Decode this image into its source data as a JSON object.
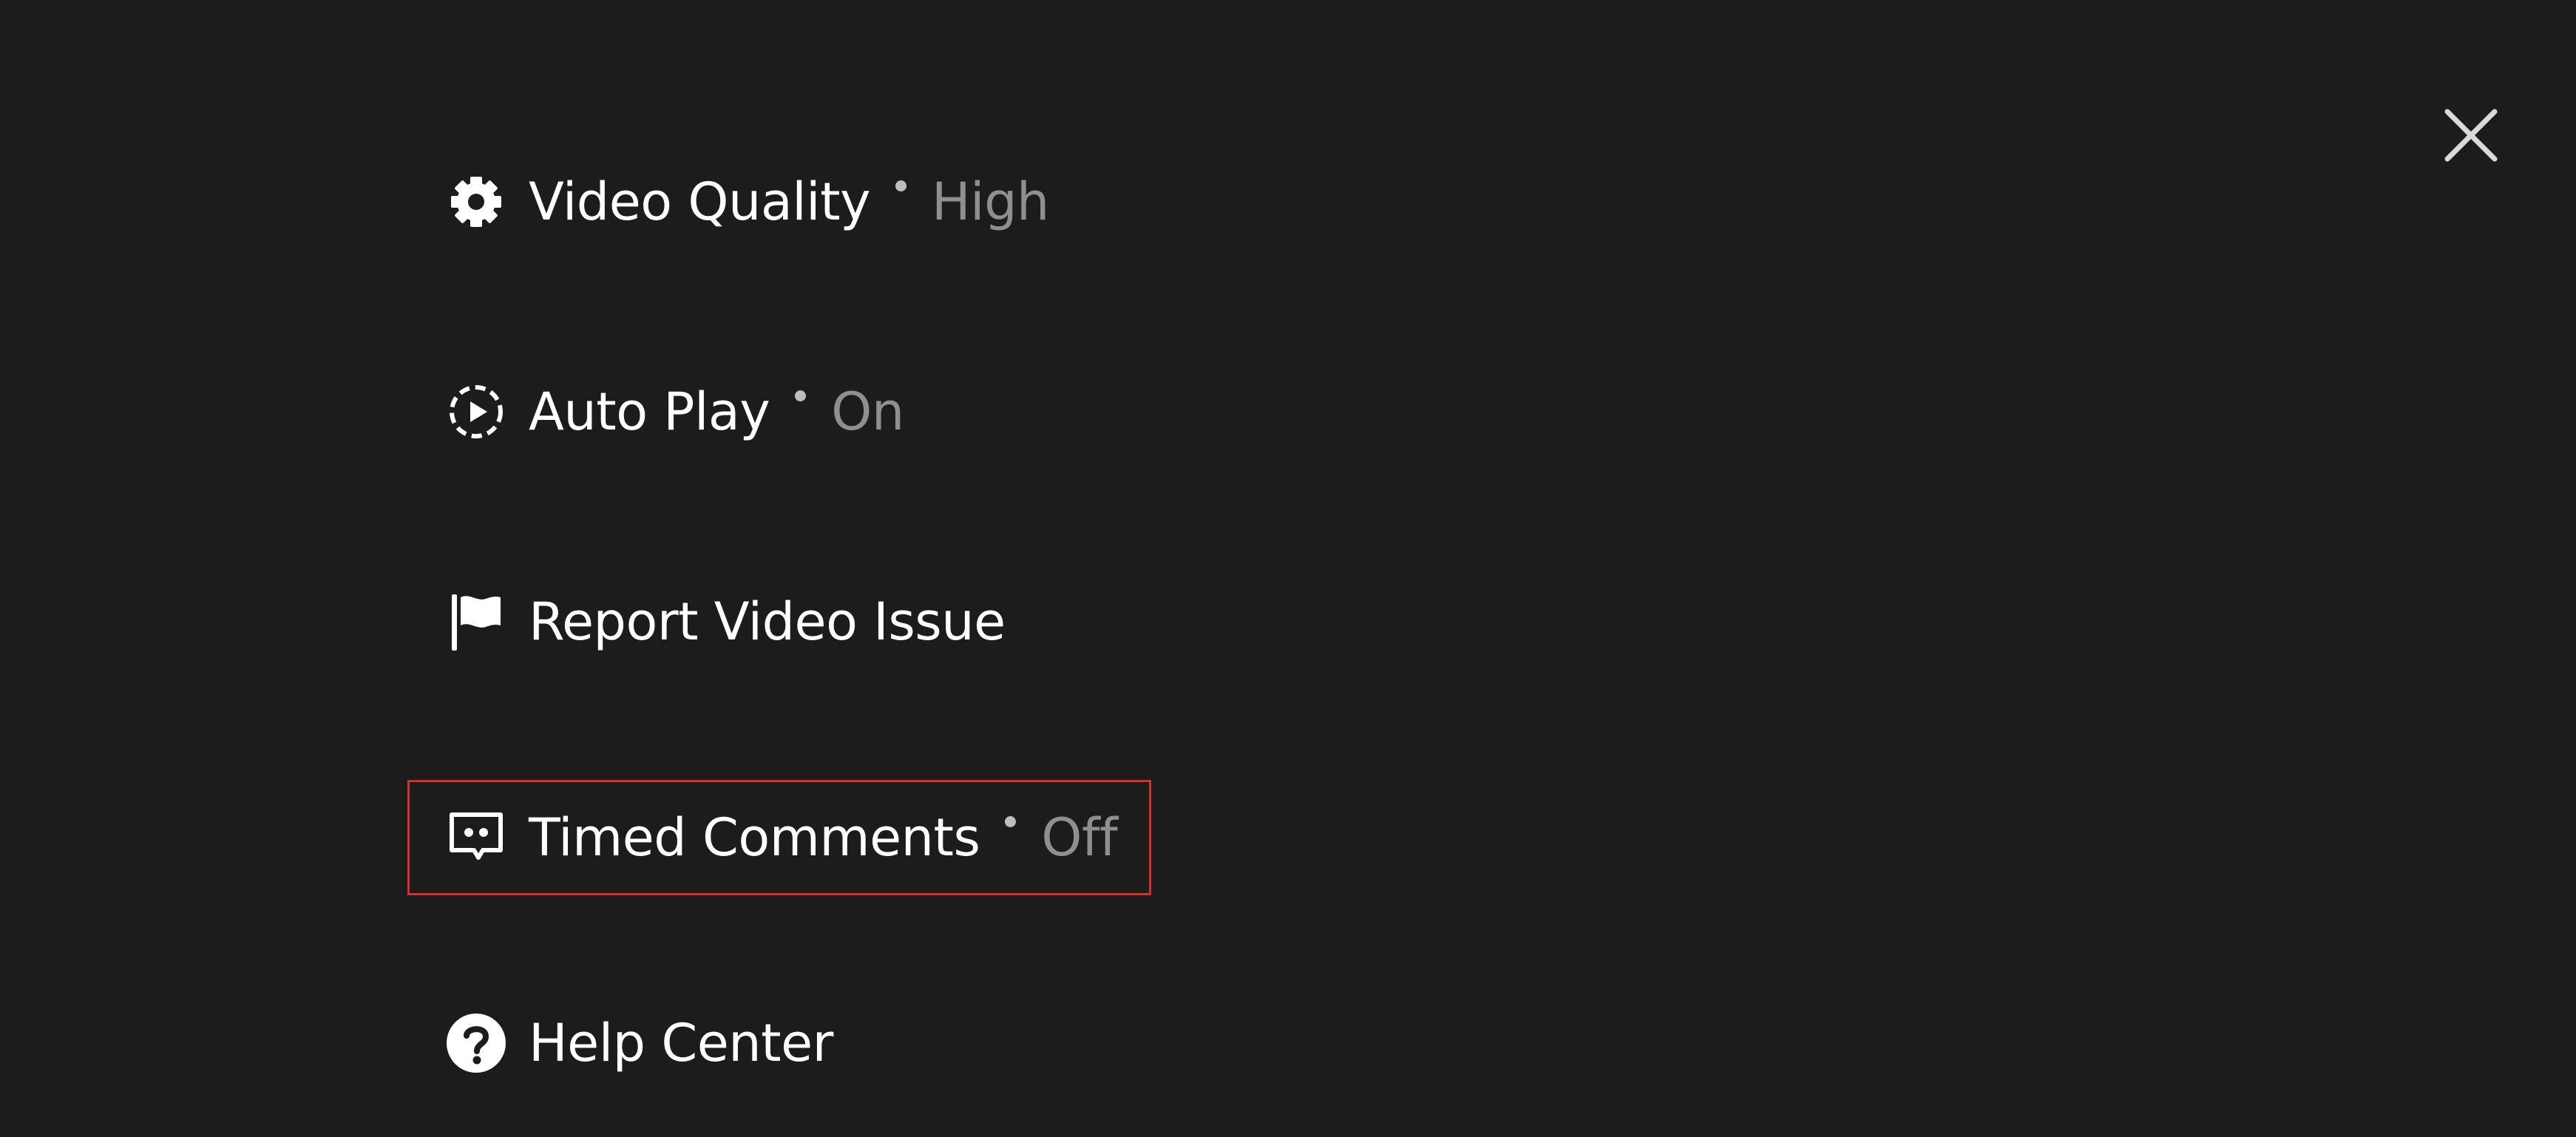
{
  "close": {
    "icon": "close-icon"
  },
  "menu": {
    "items": [
      {
        "label": "Video Quality",
        "value": "High",
        "icon": "gear-icon"
      },
      {
        "label": "Auto Play",
        "value": "On",
        "icon": "autoplay-icon"
      },
      {
        "label": "Report Video Issue",
        "value": "",
        "icon": "flag-icon"
      },
      {
        "label": "Timed Comments",
        "value": "Off",
        "icon": "comment-icon",
        "highlighted": true
      },
      {
        "label": "Help Center",
        "value": "",
        "icon": "help-icon"
      }
    ]
  },
  "colors": {
    "background": "#1c1c1c",
    "label": "#ffffff",
    "value": "#8f8f8f",
    "highlight": "#d32f2f"
  }
}
